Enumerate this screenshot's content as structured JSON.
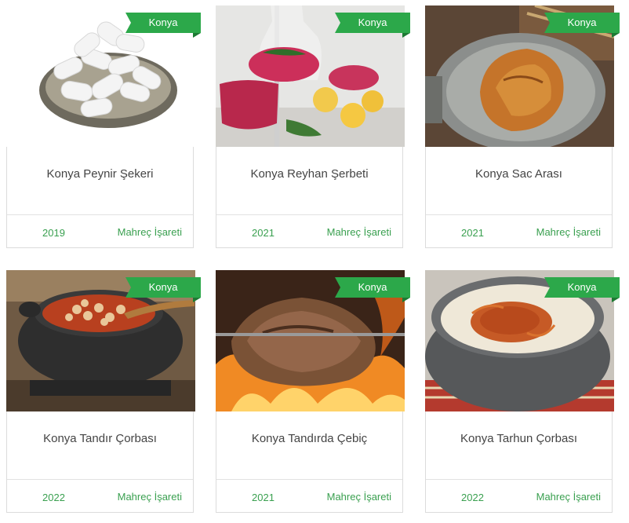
{
  "cards": [
    {
      "badge": "Konya",
      "title": "Konya Peynir Şekeri",
      "year": "2019",
      "status": "Mahreç İşareti"
    },
    {
      "badge": "Konya",
      "title": "Konya Reyhan Şerbeti",
      "year": "2021",
      "status": "Mahreç İşareti"
    },
    {
      "badge": "Konya",
      "title": "Konya Sac Arası",
      "year": "2021",
      "status": "Mahreç İşareti"
    },
    {
      "badge": "Konya",
      "title": "Konya Tandır Çorbası",
      "year": "2022",
      "status": "Mahreç İşareti"
    },
    {
      "badge": "Konya",
      "title": "Konya Tandırda Çebiç",
      "year": "2021",
      "status": "Mahreç İşareti"
    },
    {
      "badge": "Konya",
      "title": "Konya Tarhun Çorbası",
      "year": "2022",
      "status": "Mahreç İşareti"
    }
  ],
  "colors": {
    "accent": "#2ca84a",
    "link": "#3aa050",
    "title": "#444444",
    "border": "#dcdcdc"
  }
}
